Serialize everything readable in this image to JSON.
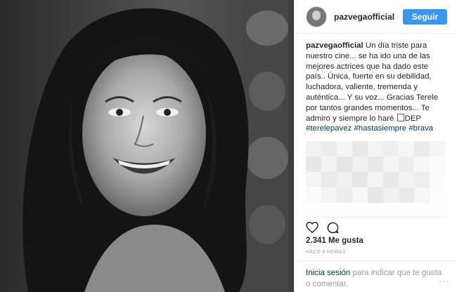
{
  "header": {
    "username": "pazvegaofficial",
    "follow_label": "Seguir"
  },
  "caption": {
    "username": "pazvegaofficial",
    "text": "Un día triste para nuestro cine... se ha ido una de las mejores actrices que ha dado este país.. Única, fuerte en su debilidad, luchadora, valiente, tremenda y auténtica... Y su voz... Gracias Terele por tantos grandes momentos... Te admiro y siempre lo haré",
    "after_emoji": "DEP",
    "hashtags": [
      "#terelepavez",
      "#hastasiempre",
      "#brava"
    ]
  },
  "stats": {
    "likes": "2.341 Me gusta",
    "time": "HACE 9 HORAS"
  },
  "comment": {
    "login_label": "Inicia sesión",
    "prompt": "para indicar que te gusta o comentar."
  },
  "more_label": "···",
  "icons": {
    "like": "heart-icon",
    "comment": "comment-icon",
    "more": "more-icon"
  },
  "colors": {
    "follow_button": "#3897f0",
    "link": "#003569",
    "muted": "#999999"
  }
}
